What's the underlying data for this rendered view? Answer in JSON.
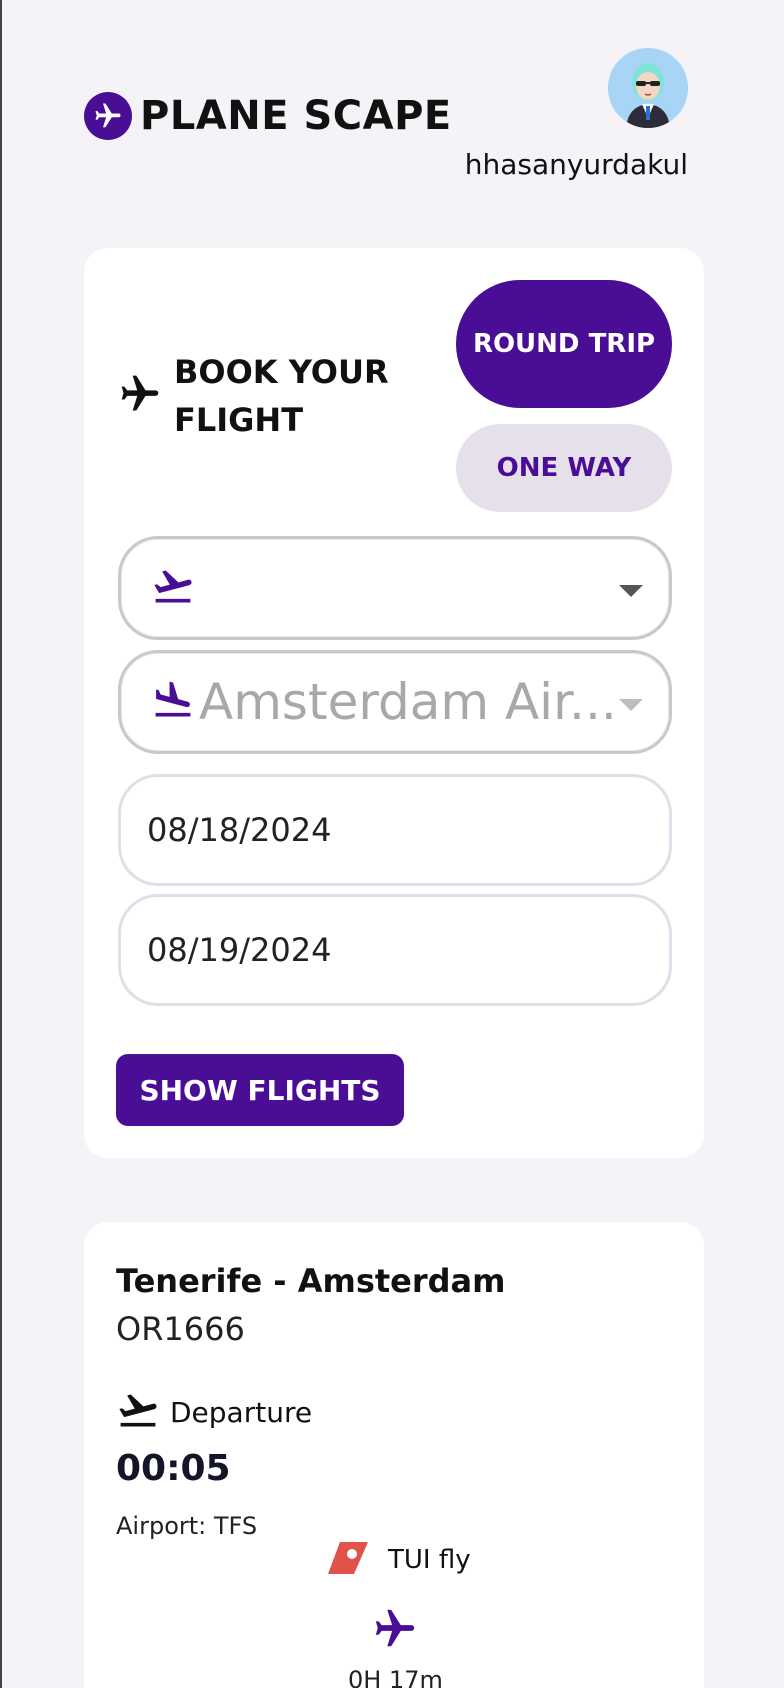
{
  "header": {
    "brand": "PLANE SCAPE",
    "username": "hhasanyurdakul"
  },
  "booking": {
    "title": "BOOK YOUR FLIGHT",
    "round_trip_label": "ROUND TRIP",
    "one_way_label": "ONE WAY",
    "from_value": "",
    "to_value": "Amsterdam Air...",
    "depart_date": "08/18/2024",
    "return_date": "08/19/2024",
    "show_flights_label": "SHOW FLIGHTS"
  },
  "flight": {
    "route": "Tenerife - Amsterdam",
    "flight_number": "OR1666",
    "departure_label": "Departure",
    "departure_time": "00:05",
    "airport": "Airport: TFS",
    "airline": "TUI fly",
    "duration": "0H 17m"
  },
  "colors": {
    "primary": "#4a0d96",
    "secondary_bg": "#e6e0ea",
    "page_bg": "#f5f3f8",
    "airline_accent": "#e0524a"
  },
  "icons": {
    "logo": "plane-circle-icon",
    "book": "plane-icon",
    "from": "plane-departure-icon",
    "to": "plane-arrival-icon",
    "dropdown": "caret-down-icon",
    "airline": "airline-tail-icon",
    "transit": "plane-icon"
  }
}
